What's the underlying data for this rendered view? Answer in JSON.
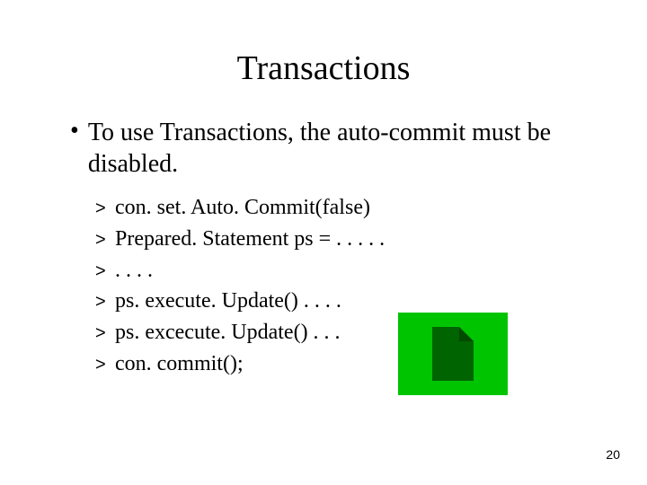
{
  "title": "Transactions",
  "bullet_main": "To use Transactions, the auto-commit must be disabled.",
  "sub_bullets": [
    "con. set. Auto. Commit(false)",
    "Prepared. Statement ps = . . . . .",
    ". . . .",
    "ps. execute. Update()  . . . .",
    "ps. excecute. Update() . . .",
    "con. commit();"
  ],
  "slide_number": "20"
}
